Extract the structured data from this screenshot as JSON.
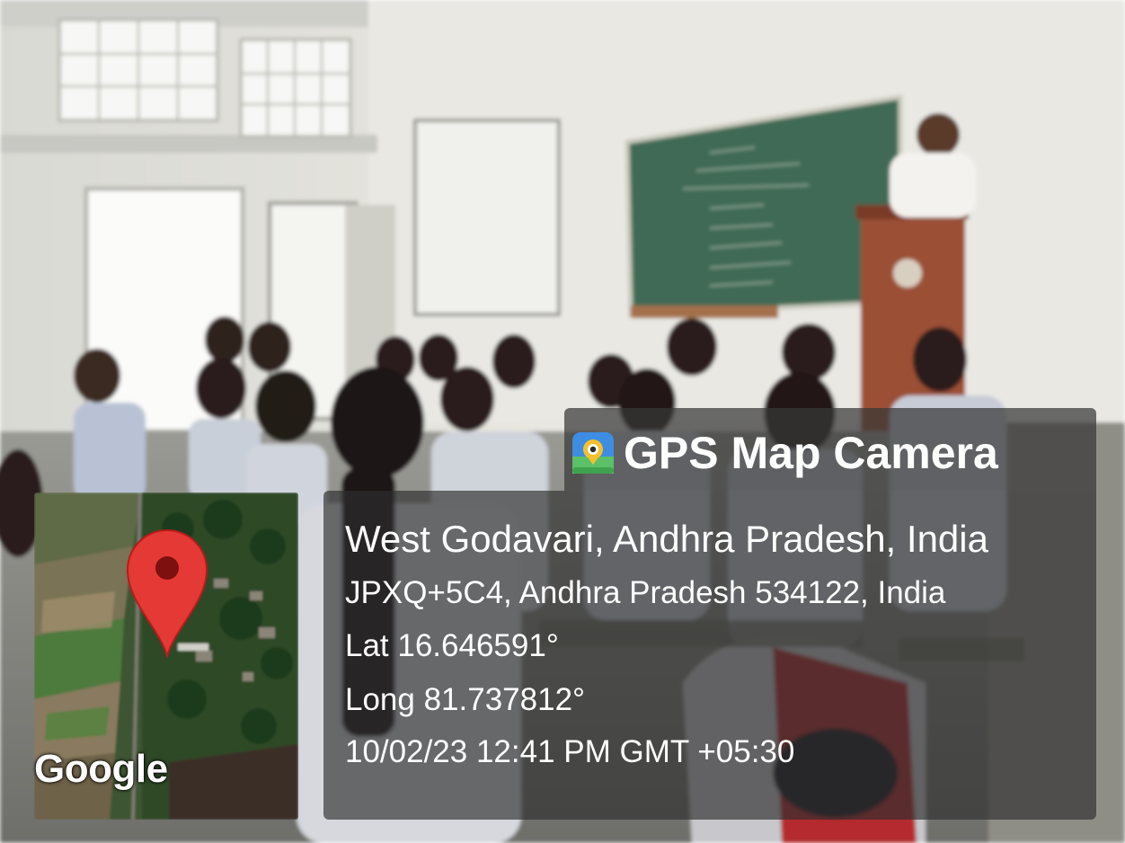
{
  "overlay": {
    "app_name": "GPS Map Camera",
    "address_line": "West Godavari, Andhra Pradesh, India",
    "plus_code_line": "JPXQ+5C4, Andhra Pradesh 534122, India",
    "latitude": "Lat 16.646591°",
    "longitude": "Long 81.737812°",
    "timestamp": "10/02/23 12:41 PM GMT +05:30"
  },
  "map": {
    "watermark": "Google",
    "marker_color": "#e53935"
  },
  "scene": {
    "icons": [
      "gps-map-camera-app-icon",
      "location-pin-icon"
    ]
  }
}
